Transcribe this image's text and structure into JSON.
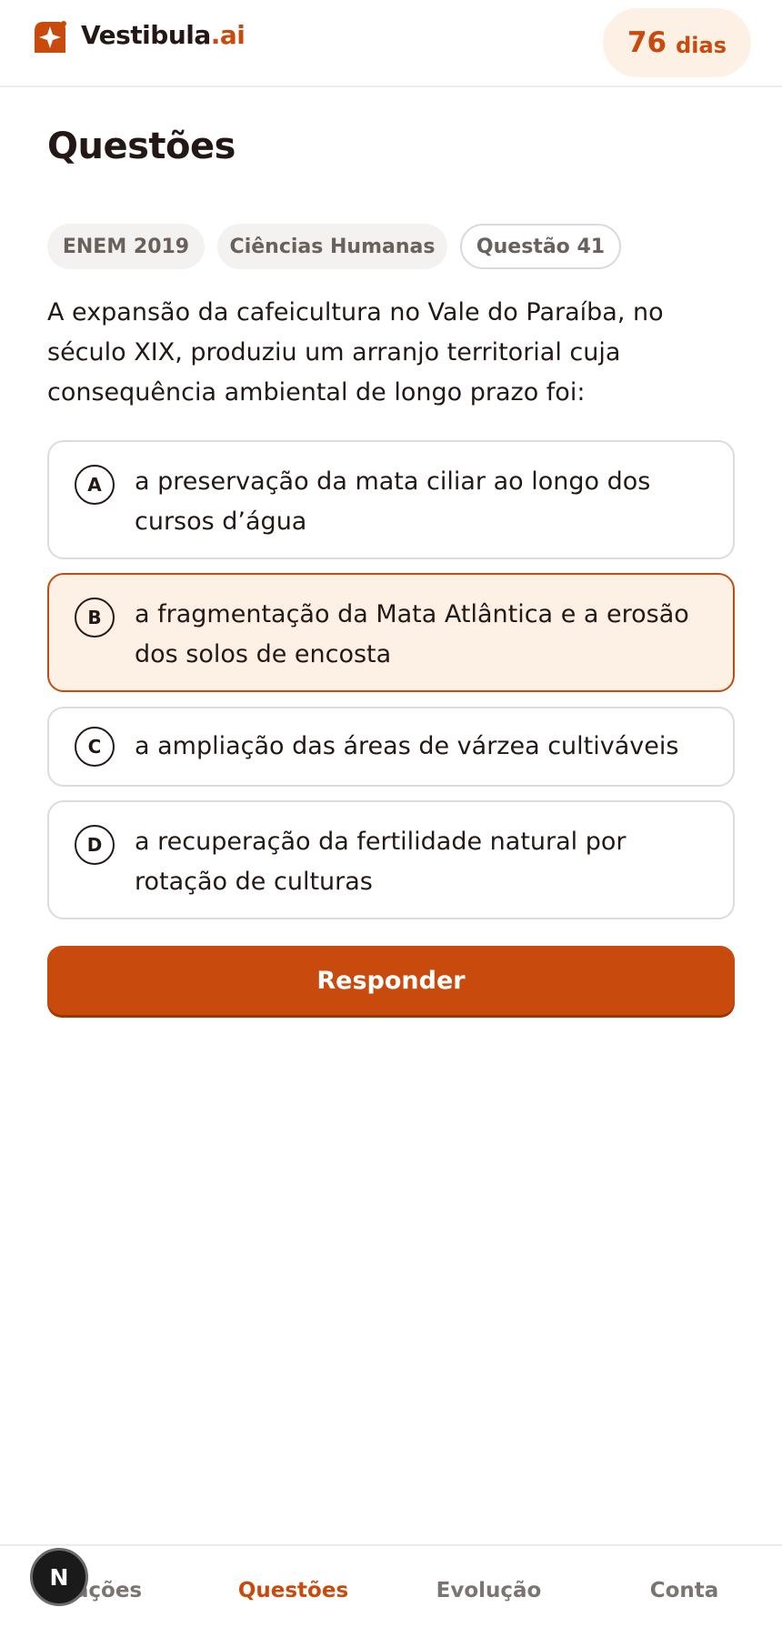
{
  "brand": {
    "name": "Vestibula",
    "suffix": ".ai",
    "logo": "rocket-icon"
  },
  "countdown": {
    "value": "76",
    "unit": "dias"
  },
  "page": {
    "title": "Questões"
  },
  "tags": [
    "ENEM 2019",
    "Ciências Humanas",
    "Questão 41"
  ],
  "question": {
    "text": "A expansão da cafeicultura no Vale do Paraíba, no século XIX, produziu um arranjo territorial cuja consequência ambiental de longo prazo foi:"
  },
  "options": [
    {
      "letter": "A",
      "text": "a preservação da mata ciliar ao longo dos cursos d’água"
    },
    {
      "letter": "B",
      "text": "a fragmentação da Mata Atlântica e a erosão dos solos de encosta"
    },
    {
      "letter": "C",
      "text": "a ampliação das áreas de várzea cultiváveis"
    },
    {
      "letter": "D",
      "text": "a recuperação da fertilidade natural por rotação de culturas"
    }
  ],
  "selected_option": "B",
  "submit": {
    "label": "Responder"
  },
  "nav": [
    "…ações",
    "Questões",
    "Evolução",
    "Conta"
  ],
  "nav_active": "Questões",
  "floating_button": {
    "label": "N"
  },
  "colors": {
    "accent": "#c94a0d",
    "accent_soft": "#fdf1e6",
    "text": "#231815",
    "muted": "#7b7471"
  }
}
